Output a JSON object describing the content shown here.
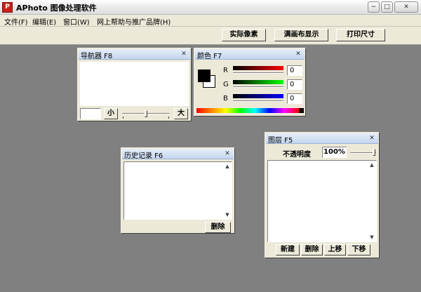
{
  "window": {
    "title": "APhoto 图像处理软件",
    "icon": "aphoto-app-icon",
    "minimize": "−",
    "maximize": "□",
    "close": "✕"
  },
  "menu": [
    {
      "label": "文件(F)"
    },
    {
      "label": "编辑(E)"
    },
    {
      "label": "窗口(W)"
    },
    {
      "label": "网上帮助与推广品牌(H)"
    }
  ],
  "toolbar": {
    "actual_pixels": "实际像素",
    "fit_screen": "满画布显示",
    "print_size": "打印尺寸"
  },
  "navigator": {
    "title": "导航器  F8",
    "close": "✕",
    "zoom_out": "小",
    "zoom_in": "大",
    "zoom_level": 0.5
  },
  "color": {
    "title": "颜色  F7",
    "close": "✕",
    "foreground": "#000000",
    "background": "#ffffff",
    "channels": [
      {
        "label": "R",
        "value": "0",
        "color": "#e00000"
      },
      {
        "label": "G",
        "value": "0",
        "color": "#00c000"
      },
      {
        "label": "B",
        "value": "0",
        "color": "#0000e0"
      }
    ]
  },
  "history": {
    "title": "历史记录  F6",
    "close": "✕",
    "delete": "删除"
  },
  "layers": {
    "title": "图层  F5",
    "close": "✕",
    "opacity_label": "不透明度",
    "opacity_value": "100%",
    "buttons": {
      "new": "新建",
      "delete": "删除",
      "up": "上移",
      "down": "下移"
    }
  }
}
